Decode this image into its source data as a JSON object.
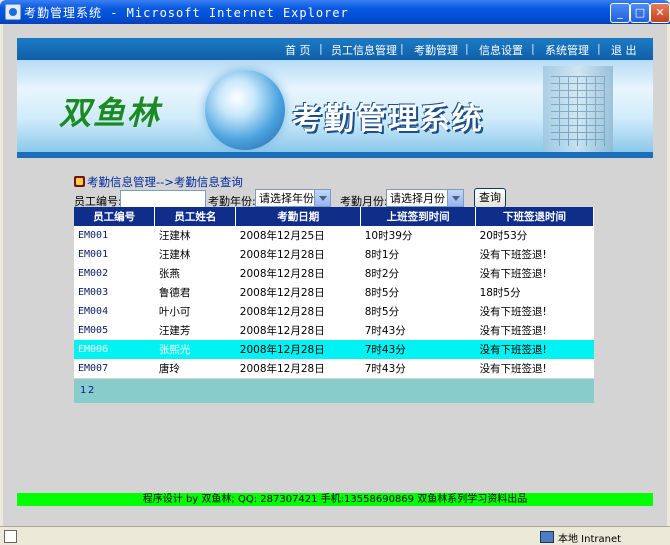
{
  "window": {
    "title": "考勤管理系统 - Microsoft Internet Explorer"
  },
  "nav": [
    "首 页",
    "员工信息管理",
    "考勤管理",
    "信息设置",
    "系统管理",
    "退 出"
  ],
  "banner": {
    "brand": "双鱼林",
    "system": "考勤管理系统"
  },
  "breadcrumb": "考勤信息管理-->考勤信息查询",
  "filters": {
    "employee_id_label": "员工编号:",
    "employee_id_value": "",
    "year_label": "考勤年份:",
    "year_selected": "请选择年份",
    "month_label": "考勤月份:",
    "month_selected": "请选择月份",
    "query_button": "查询"
  },
  "table": {
    "headers": [
      "员工编号",
      "员工姓名",
      "考勤日期",
      "上班签到时间",
      "下班签退时间"
    ],
    "rows": [
      [
        "EM001",
        "汪建林",
        "2008年12月25日",
        "10时39分",
        "20时53分"
      ],
      [
        "EM001",
        "汪建林",
        "2008年12月28日",
        "8时1分",
        "没有下班签退!"
      ],
      [
        "EM002",
        "张燕",
        "2008年12月28日",
        "8时2分",
        "没有下班签退!"
      ],
      [
        "EM003",
        "鲁德君",
        "2008年12月28日",
        "8时5分",
        "18时5分"
      ],
      [
        "EM004",
        "叶小可",
        "2008年12月28日",
        "8时5分",
        "没有下班签退!"
      ],
      [
        "EM005",
        "汪建芳",
        "2008年12月28日",
        "7时43分",
        "没有下班签退!"
      ],
      [
        "EM006",
        "张熙光",
        "2008年12月28日",
        "7时43分",
        "没有下班签退!"
      ],
      [
        "EM007",
        "唐玲",
        "2008年12月28日",
        "7时43分",
        "没有下班签退!"
      ]
    ],
    "highlighted_row": 6
  },
  "pager": [
    "1",
    "2"
  ],
  "footer": "程序设计 by 双鱼林; QQ: 287307421 手机:13558690869 双鱼林系列学习资料出品",
  "status": {
    "zone": "本地 Intranet"
  },
  "colors": {
    "nav": "#1c7bc4",
    "table_header": "#0f2e8a",
    "highlight": "#00f2f2",
    "pager": "#88cccc",
    "footer": "#00ff00"
  }
}
